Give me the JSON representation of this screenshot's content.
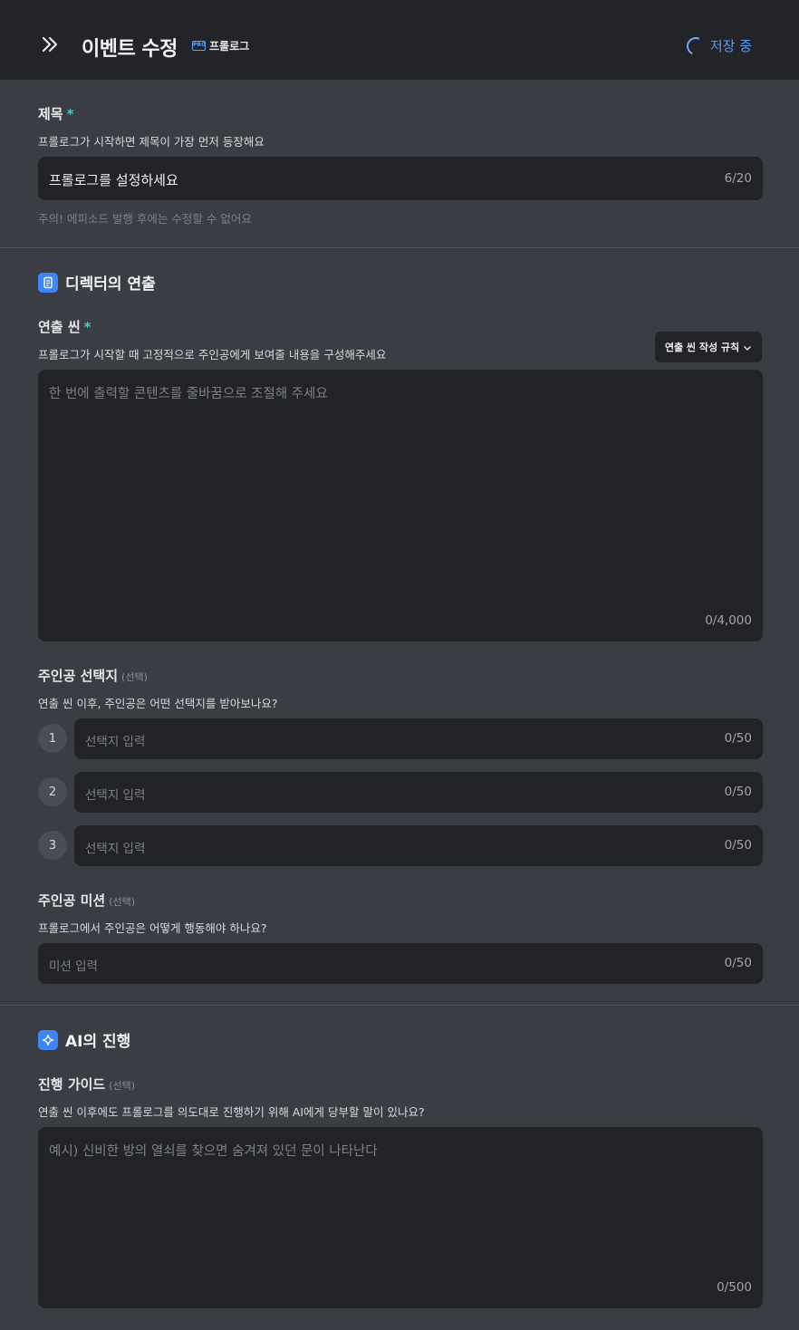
{
  "header": {
    "title": "이벤트 수정",
    "badge_icon": "PRO",
    "badge_label": "프롤로그",
    "saving_label": "저장 중"
  },
  "title_section": {
    "label": "제목",
    "required_mark": "*",
    "description": "프롤로그가 시작하면 제목이 가장 먼저 등장해요",
    "value": "프롤로그를 설정하세요",
    "counter": "6/20",
    "hint": "주의! 에피소드 발행 후에는 수정할 수 없어요"
  },
  "director_section": {
    "heading": "디렉터의 연출",
    "scene": {
      "label": "연출 씬",
      "required_mark": "*",
      "description": "프롤로그가 시작할 때 고정적으로 주인공에게 보여줄 내용을 구성해주세요",
      "rule_button": "연출 씬 작성 규칙",
      "placeholder": "한 번에 출력할 콘텐츠를 줄바꿈으로 조절해 주세요",
      "counter": "0/4,000"
    },
    "choices": {
      "label": "주인공 선택지",
      "optional_mark": "(선택)",
      "description": "연출 씬 이후, 주인공은 어떤 선택지를 받아보나요?",
      "items": [
        {
          "num": "1",
          "placeholder": "선택지 입력",
          "counter": "0/50"
        },
        {
          "num": "2",
          "placeholder": "선택지 입력",
          "counter": "0/50"
        },
        {
          "num": "3",
          "placeholder": "선택지 입력",
          "counter": "0/50"
        }
      ]
    },
    "mission": {
      "label": "주인공 미션",
      "optional_mark": "(선택)",
      "description": "프롤로그에서 주인공은 어떻게 행동해야 하나요?",
      "placeholder": "미션 입력",
      "counter": "0/50"
    }
  },
  "ai_section": {
    "heading": "AI의 진행",
    "guide": {
      "label": "진행 가이드",
      "optional_mark": "(선택)",
      "description": "연출 씬 이후에도 프롤로그를 의도대로 진행하기 위해 AI에게 당부할 말이 있나요?",
      "placeholder": "예시) 신비한 방의 열쇠를 찾으면 숨겨져 있던 문이 나타난다",
      "counter": "0/500"
    }
  },
  "colors": {
    "accent": "#3d86f5",
    "required": "#3fd0d0",
    "field_bg": "#222327",
    "page_bg": "#3a3d43",
    "header_bg": "#232428"
  }
}
